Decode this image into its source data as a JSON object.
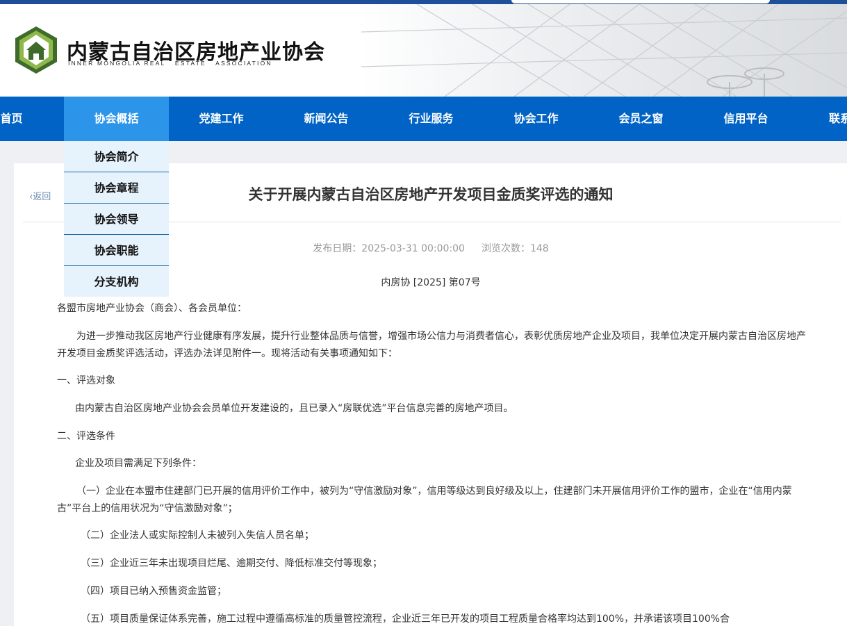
{
  "header": {
    "logo_cn": "内蒙古自治区房地产业协会",
    "logo_en": "INNER MONGOLIA REAL   ESTATE   ASSOCIATION",
    "logo_icon": "house-hexagon-logo",
    "brand_color": "#0063c5",
    "active_color": "#2d95e9"
  },
  "nav": {
    "items": [
      "首页",
      "协会概括",
      "党建工作",
      "新闻公告",
      "行业服务",
      "协会工作",
      "会员之窗",
      "信用平台",
      "联系"
    ],
    "active": "协会概括"
  },
  "dropdown": {
    "items": [
      "协会简介",
      "协会章程",
      "协会领导",
      "协会职能",
      "分支机构"
    ]
  },
  "article": {
    "back": "返回",
    "title": "关于开展内蒙古自治区房地产开发项目金质奖评选的通知",
    "publish": "发布日期：2025-03-31 00:00:00",
    "views": "浏览次数：148",
    "doc_number": "内房协 [2025] 第07号",
    "salutation": "各盟市房地产业协会（商会）、各会员单位：",
    "p1": "为进一步推动我区房地产行业健康有序发展，提升行业整体品质与信誉，增强市场公信力与消费者信心，表彰优质房地产企业及项目，我单位决定开展内蒙古自治区房地产开发项目金质奖评选活动，评选办法详见附件一。现将活动有关事项通知如下：",
    "s1": "一、评选对象",
    "p2": "由内蒙古自治区房地产业协会会员单位开发建设的，且已录入“房联优选”平台信息完善的房地产项目。",
    "s2": "二、评选条件",
    "p3": "企业及项目需满足下列条件：",
    "c1": "（一）企业在本盟市住建部门已开展的信用评价工作中，被列为“守信激励对象”，信用等级达到良好级及以上，住建部门未开展信用评价工作的盟市，企业在“信用内蒙古”平台上的信用状况为“守信激励对象”；",
    "c2": "（二）企业法人或实际控制人未被列入失信人员名单；",
    "c3": "（三）企业近三年未出现项目烂尾、逾期交付、降低标准交付等现象；",
    "c4": "（四）项目已纳入预售资金监管；",
    "c5": "（五）项目质量保证体系完善，施工过程中遵循高标准的质量管控流程，企业近三年已开发的项目工程质量合格率均达到100%，并承诺该项目100%合"
  }
}
